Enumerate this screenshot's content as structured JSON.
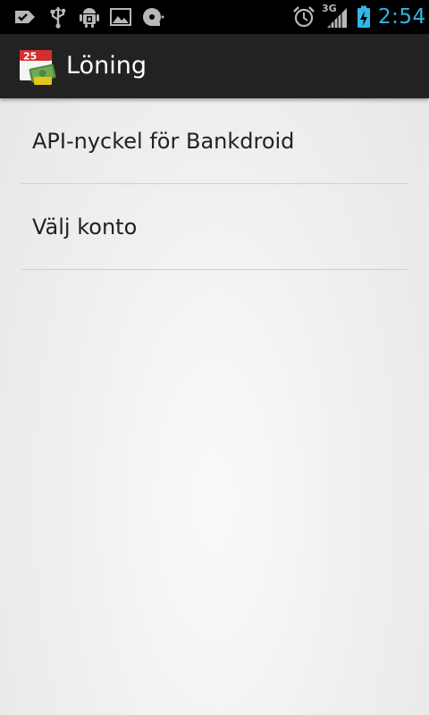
{
  "status_bar": {
    "time": "2:54",
    "network": "3G",
    "icons": [
      "notification-check-icon",
      "usb-icon",
      "android-debug-icon",
      "image-icon",
      "disk-sync-icon",
      "alarm-icon",
      "signal-3g-icon",
      "battery-charging-icon"
    ],
    "accent_color": "#33b5e5"
  },
  "action_bar": {
    "title": "Löning",
    "icon_day": "25"
  },
  "preferences": [
    {
      "label": "API-nyckel för Bankdroid"
    },
    {
      "label": "Välj konto"
    }
  ]
}
